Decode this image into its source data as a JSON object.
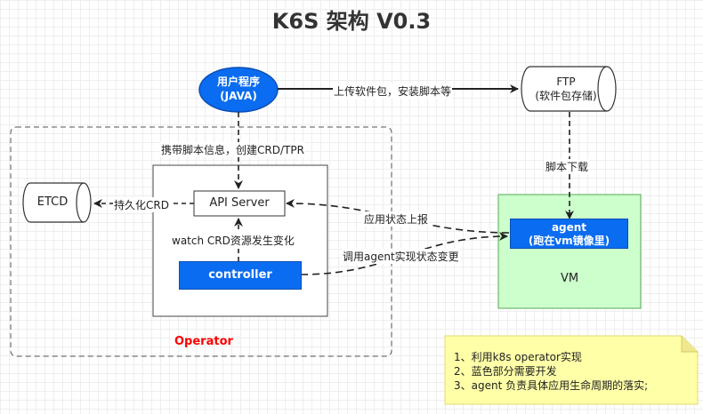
{
  "title": "K6S 架构 V0.3",
  "user_program": {
    "line1": "用户程序",
    "line2": "(JAVA)"
  },
  "ftp": {
    "line1": "FTP",
    "line2": "(软件包存储)"
  },
  "etcd": {
    "label": "ETCD"
  },
  "api_server": {
    "label": "API Server"
  },
  "controller": {
    "label": "controller"
  },
  "agent": {
    "line1": "agent",
    "line2": "(跑在vm镜像里)"
  },
  "vm": {
    "label": "VM"
  },
  "operator": {
    "label": "Operator"
  },
  "edges": {
    "upload": "上传软件包，安装脚本等",
    "carry_script": "携带脚本信息，创建CRD/TPR",
    "download_script": "脚本下载",
    "persist_crd": "持久化CRD",
    "watch_crd": "watch CRD资源发生变化",
    "report_status": "应用状态上报",
    "invoke_agent": "调用agent实现状态变更"
  },
  "note": {
    "lines": [
      "1、利用k8s operator实现",
      "2、蓝色部分需要开发",
      "3、agent 负责具体应用生命周期的落实;"
    ]
  },
  "colors": {
    "blue": "#0a6cf0",
    "vm_fill": "#ccffcc",
    "note_fill": "#ffffa8",
    "operator_text": "#ff0000"
  }
}
